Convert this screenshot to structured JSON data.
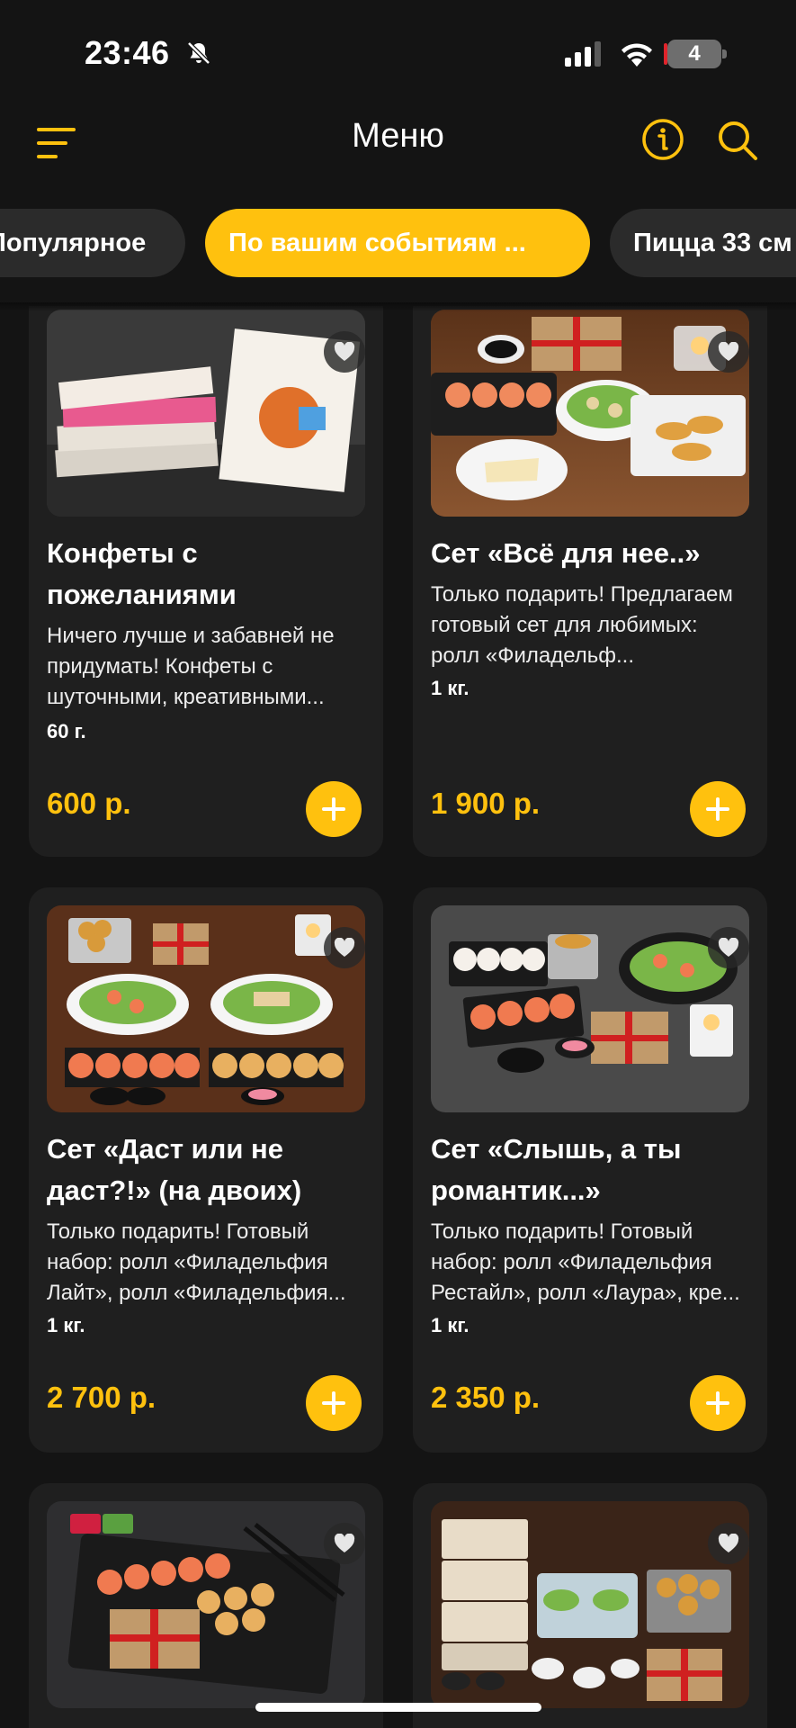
{
  "status_bar": {
    "time": "23:46",
    "battery_level": "4",
    "icons": [
      "bell-slash-icon",
      "cellular-signal-icon",
      "wifi-icon",
      "battery-icon"
    ]
  },
  "header": {
    "title": "Меню",
    "icons": [
      "menu-icon",
      "info-icon",
      "search-icon"
    ]
  },
  "tabs": [
    {
      "label": "Популярное",
      "active": false
    },
    {
      "label": "По вашим событиям ...",
      "active": true
    },
    {
      "label": "Пицца 33 см",
      "active": false
    }
  ],
  "products": [
    {
      "name": "Конфеты с пожеланиями",
      "description": "Ничего лучше и забавней не придумать! Конфеты с шуточными, креативными...",
      "weight": "60 г.",
      "price": "600 р."
    },
    {
      "name": "Сет «Всё для нее..»",
      "description": "Только подарить! Предлагаем готовый сет для любимых: ролл «Филадельф...",
      "weight": "1 кг.",
      "price": "1 900 р."
    },
    {
      "name": "Сет «Даст или не даст?!» (на двоих)",
      "description": "Только подарить! Готовый набор: ролл «Филадельфия Лайт», ролл «Филадельфия...",
      "weight": "1 кг.",
      "price": "2 700 р."
    },
    {
      "name": "Сет «Слышь, а ты романтик...»",
      "description": "Только подарить! Готовый набор: ролл «Филадельфия Рестайл», ролл «Лаура», кре...",
      "weight": "1 кг.",
      "price": "2 350 р."
    }
  ],
  "colors": {
    "accent": "#ffc10e",
    "background": "#141414",
    "card": "#1f1f1f"
  }
}
